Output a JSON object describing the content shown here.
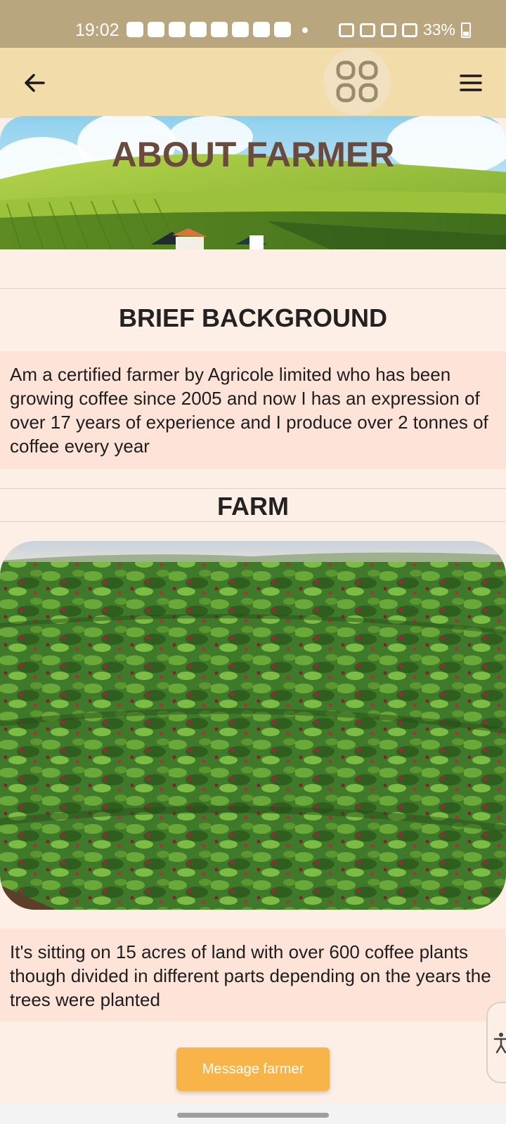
{
  "status_bar": {
    "time": "19:02",
    "battery": "33%"
  },
  "top_bar": {
    "back_icon": "arrow-left-icon",
    "logo_icon": "grid-logo-icon",
    "menu_icon": "hamburger-menu-icon"
  },
  "hero": {
    "title": "ABOUT FARMER"
  },
  "background_section": {
    "title": "BRIEF BACKGROUND",
    "text": "Am a certified farmer by Agricole limited who has been growing coffee since 2005 and now I has an expression of over 17 years of experience and I produce over 2 tonnes of coffee every year"
  },
  "farm_section": {
    "title": "FARM",
    "text": "It's sitting on 15 acres of land with over 600 coffee plants though divided in different parts depending on the years the trees were planted"
  },
  "actions": {
    "message_label": "Message farmer"
  },
  "accessibility": {
    "icon": "accessibility-icon"
  },
  "colors": {
    "status_bar": "#b9a67f",
    "top_bar": "#f2ddaa",
    "page_bg": "#fdeee6",
    "card_bg": "#fde3d8",
    "hero_title": "#6a4a3c",
    "button": "#f8b449"
  }
}
